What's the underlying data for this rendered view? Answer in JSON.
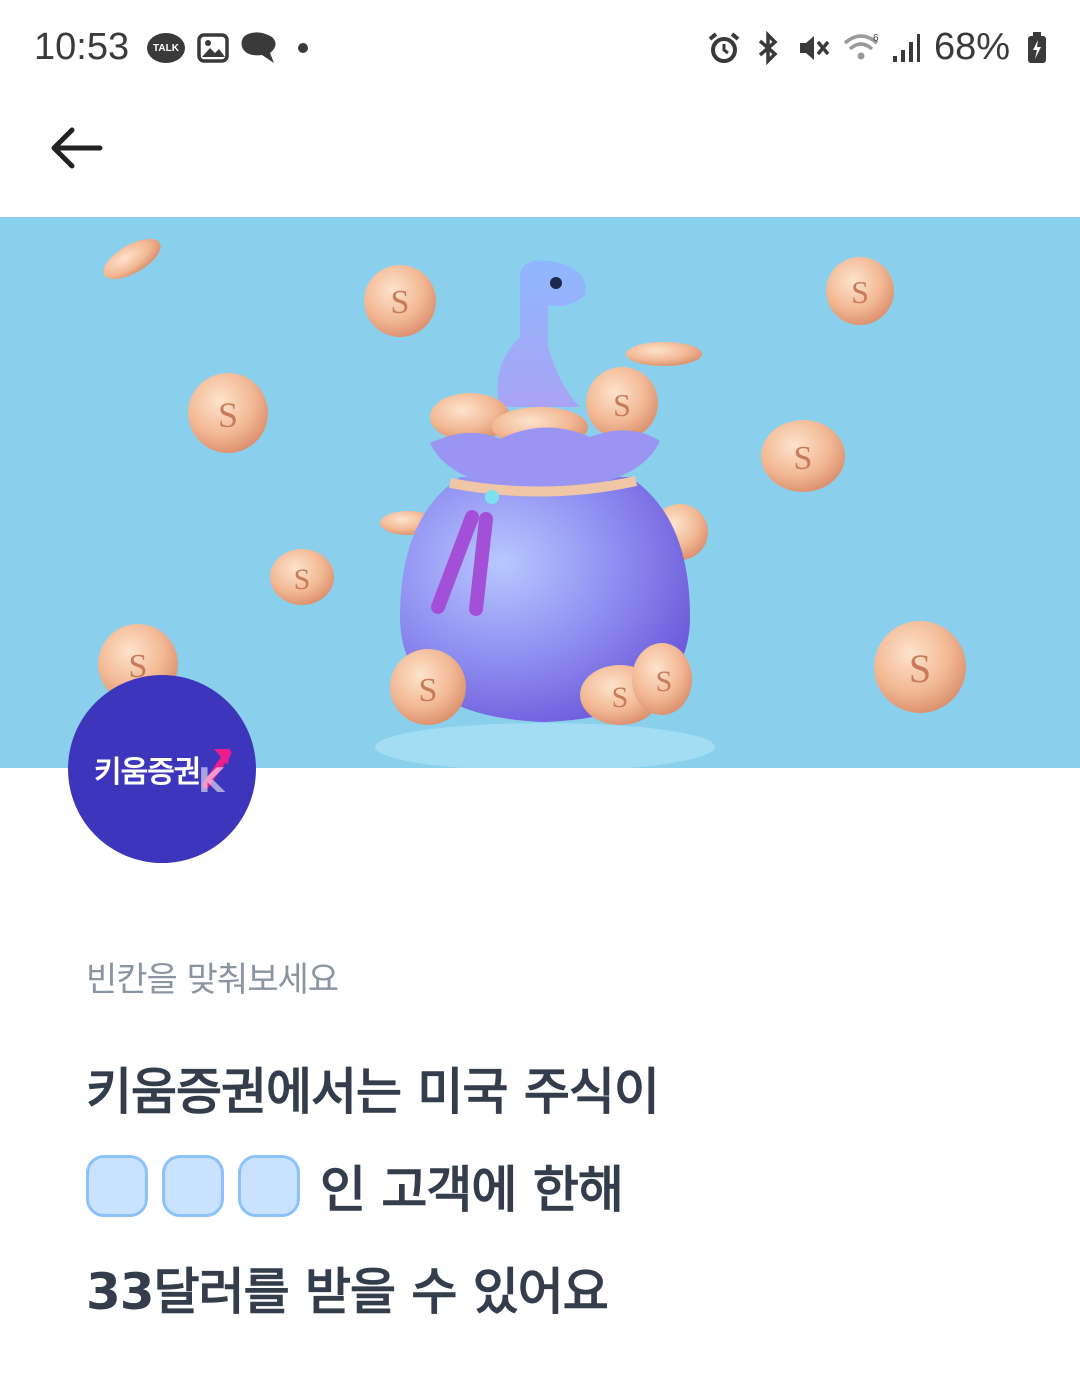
{
  "status_bar": {
    "time": "10:53",
    "talk_badge": "TALK",
    "battery_percent": "68%"
  },
  "header": {
    "back_icon": "arrow-left-icon"
  },
  "banner": {
    "background_color": "#8ad0ec",
    "coin_letter": "S"
  },
  "logo": {
    "brand_name": "키움증권",
    "brand_letter": "K",
    "background_color": "#3d35bc"
  },
  "quiz": {
    "hint": "빈칸을 맞춰보세요",
    "line1": "키움증권에서는 미국 주식이",
    "blank_count": 3,
    "line2_suffix": "인 고객에 한해",
    "line3": "33달러를 받을 수 있어요"
  }
}
